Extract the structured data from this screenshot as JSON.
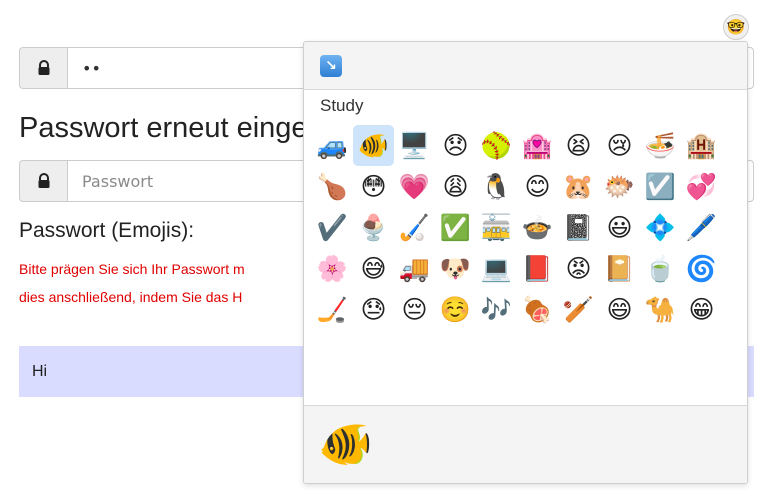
{
  "password_field": {
    "value": "••",
    "icon": "lock-icon"
  },
  "repeat": {
    "heading": "Passwort erneut eingeben",
    "placeholder": "Passwort",
    "icon": "lock-icon"
  },
  "emoji_section": {
    "heading": "Passwort (Emojis):",
    "hint_line1": "Bitte prägen Sie sich Ihr Passwort m",
    "hint_line2": "dies anschließend, indem Sie das H"
  },
  "hi_bar": {
    "text": "Hi"
  },
  "trigger": {
    "emoji": "🤓"
  },
  "picker": {
    "header_icon": "↘",
    "category": "Study",
    "emojis": [
      "🚙",
      "🐠",
      "🖥️",
      "😞",
      "🥎",
      "🏩",
      "😫",
      "😢",
      "🍜",
      "🏨",
      "🍗",
      "😳",
      "💗",
      "😩",
      "🐧",
      "😊",
      "🐹",
      "🐡",
      "☑️",
      "💞",
      "✔️",
      "🍨",
      "🏑",
      "✅",
      "🚋",
      "🍲",
      "📓",
      "😃",
      "💠",
      "🖊️",
      "🌸",
      "😅",
      "🚚",
      "🐶",
      "💻",
      "📕",
      "😡",
      "📔",
      "🍵",
      "🌀",
      "🏒",
      "😓",
      "😔",
      "☺️",
      "🎶",
      "🍖",
      "🏏",
      "😄",
      "🐪",
      "😁"
    ],
    "selected_index": 1,
    "preview": "🐠"
  },
  "colors": {
    "hint_red": "#e00000",
    "hi_bar_bg": "#d9dbff",
    "selected_bg": "#cde4fb"
  }
}
